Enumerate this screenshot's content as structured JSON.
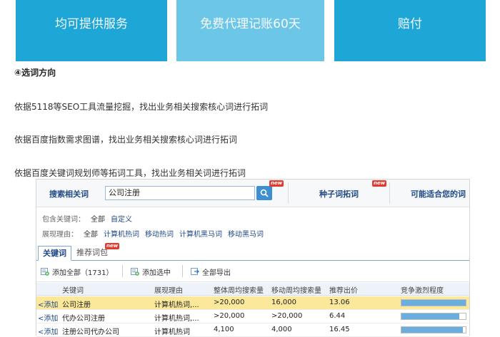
{
  "banners": [
    {
      "line1": "均可提供服务"
    },
    {
      "line1": "免费代理记账60天"
    },
    {
      "line1": "赔付"
    }
  ],
  "step_heading": "④选词方向",
  "paragraphs": [
    "依据5118等SEO工具流量挖掘，找出业务相关搜索核心词进行拓词",
    "依据百度指数需求图谱，找出业务相关搜索核心词进行拓词",
    "依据百度关键词规划师等拓词工具，找出业务相关词进行拓词"
  ],
  "tool": {
    "search_label": "搜索相关词",
    "search_value": "公司注册",
    "new_badge": "new",
    "tab_seed": "种子词拓词",
    "tab_possible": "可能适合您的词",
    "include_label": "包含关键词：",
    "include_options": [
      "全部",
      "自定义"
    ],
    "reason_label": "展现理由：",
    "reason_options": [
      "全部",
      "计算机热词",
      "移动热词",
      "计算机黑马词",
      "移动黑马词"
    ],
    "tab_keywords": "关键词",
    "tab_recommend": "推荐词包",
    "add_all": "添加全部（1731）",
    "add_selected": "添加选中",
    "export_all": "全部导出",
    "columns": [
      "关键词",
      "展现理由",
      "整体周均搜索量",
      "移动周均搜索量",
      "推荐出价",
      "竞争激烈程度"
    ],
    "rows": [
      {
        "add": "<添加",
        "keyword": "公司注册",
        "reason": "计算机热词,...",
        "total": ">20,000",
        "mobile": "16,000",
        "bid": "13.06",
        "competition": 1.0
      },
      {
        "add": "<添加",
        "keyword": "代办公司注册",
        "reason": "计算机热词,...",
        "total": ">20,000",
        "mobile": ">20,000",
        "bid": "6.44",
        "competition": 0.9
      },
      {
        "add": "<添加",
        "keyword": "注册公司代办公司",
        "reason": "计算机热词",
        "total": "4,100",
        "mobile": "4,000",
        "bid": "16.45",
        "competition": 0.95
      }
    ]
  },
  "colors": {
    "banner": "#1ea6d6",
    "banner_light": "#6cc6e8",
    "selected_row": "#fbe89a",
    "link": "#204a87"
  }
}
